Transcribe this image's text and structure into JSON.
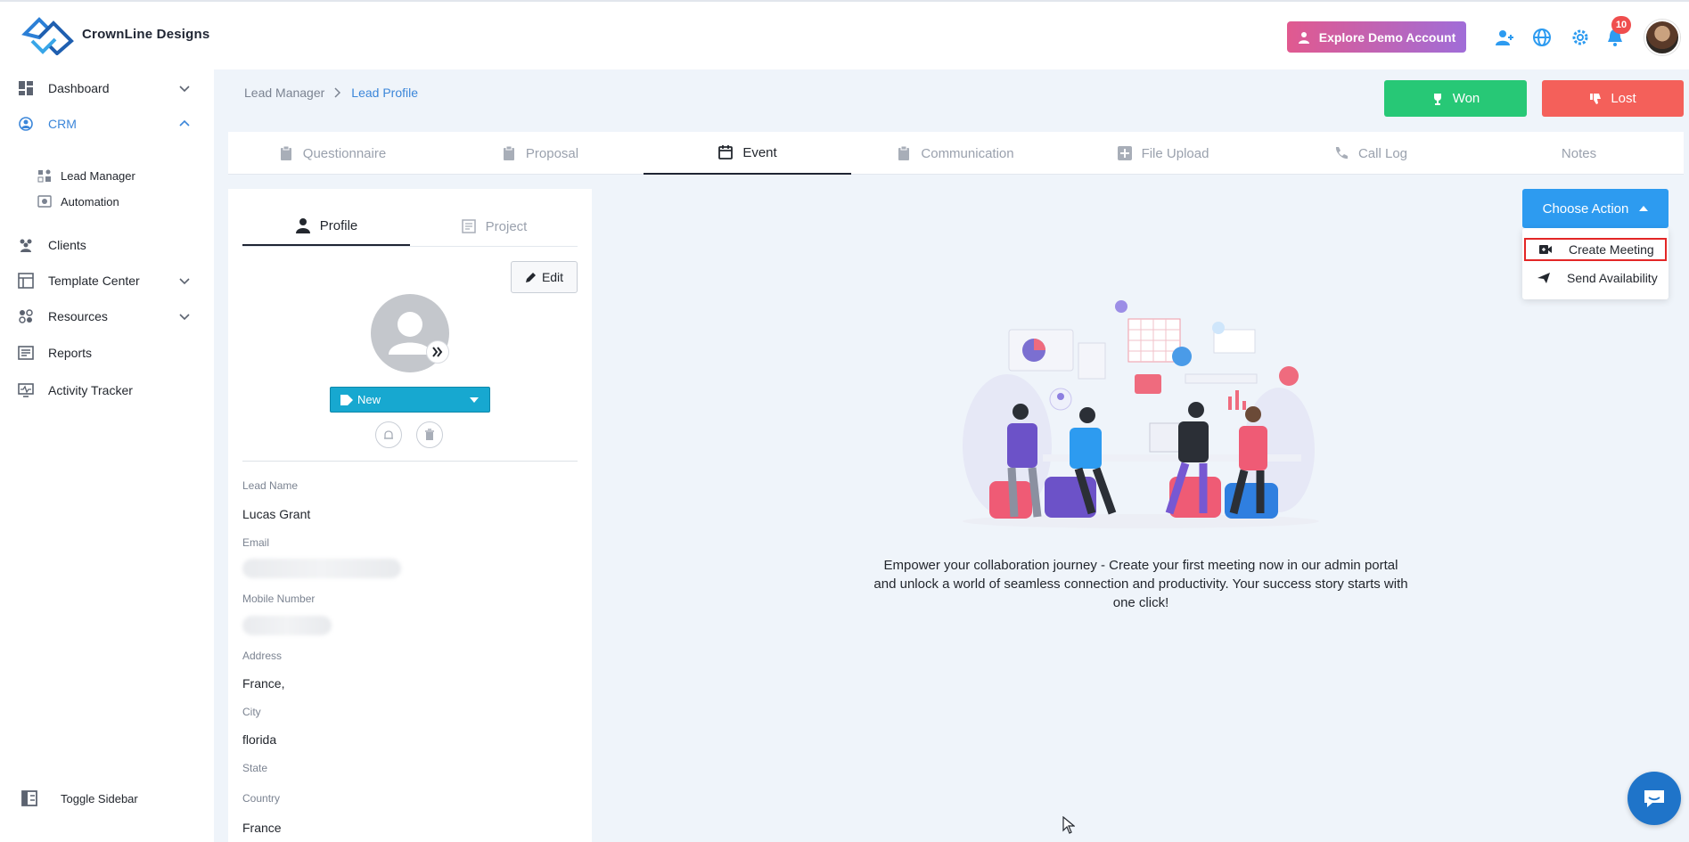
{
  "brand": {
    "name": "CrownLine Designs"
  },
  "header": {
    "demo_label": "Explore Demo Account",
    "notification_count": "10"
  },
  "sidebar": {
    "items": [
      {
        "label": "Dashboard"
      },
      {
        "label": "CRM"
      },
      {
        "label": "Clients"
      },
      {
        "label": "Template Center"
      },
      {
        "label": "Resources"
      },
      {
        "label": "Reports"
      },
      {
        "label": "Activity Tracker"
      }
    ],
    "crm_sub": [
      {
        "label": "Lead Manager"
      },
      {
        "label": "Automation"
      }
    ],
    "toggle_label": "Toggle Sidebar"
  },
  "breadcrumb": {
    "parent": "Lead Manager",
    "current": "Lead Profile"
  },
  "status_buttons": {
    "won": "Won",
    "lost": "Lost"
  },
  "tabs": [
    {
      "label": "Questionnaire"
    },
    {
      "label": "Proposal"
    },
    {
      "label": "Event"
    },
    {
      "label": "Communication"
    },
    {
      "label": "File Upload"
    },
    {
      "label": "Call Log"
    },
    {
      "label": "Notes"
    }
  ],
  "profile": {
    "tabs": [
      {
        "label": "Profile"
      },
      {
        "label": "Project"
      }
    ],
    "edit_label": "Edit",
    "status": "New",
    "fields": {
      "lead_name_label": "Lead Name",
      "lead_name": "Lucas Grant",
      "email_label": "Email",
      "mobile_label": "Mobile Number",
      "address_label": "Address",
      "address": "France,",
      "city_label": "City",
      "city": "florida",
      "state_label": "State",
      "country_label": "Country",
      "country": "France"
    }
  },
  "action": {
    "button_label": "Choose Action",
    "menu": [
      {
        "label": "Create Meeting"
      },
      {
        "label": "Send Availability"
      }
    ]
  },
  "empty_state": {
    "message": "Empower your collaboration journey - Create your first meeting now in our admin portal and unlock a world of seamless connection and productivity. Your success story starts with one click!"
  },
  "colors": {
    "accent": "#2d9bf0",
    "won": "#27c876",
    "lost": "#f4605a",
    "status_new": "#17a8d0",
    "highlight": "#e32626"
  }
}
